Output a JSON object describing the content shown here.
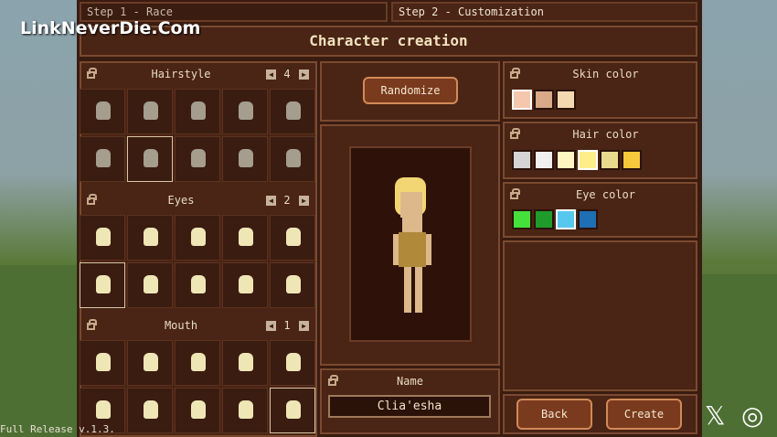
{
  "watermark": "LinkNeverDie.Com",
  "version_text": "Full Release v.1.3.",
  "tabs": [
    {
      "label": "Step 1 - Race"
    },
    {
      "label": "Step 2 - Customization"
    }
  ],
  "title": "Character creation",
  "hairstyle": {
    "label": "Hairstyle",
    "value": "4"
  },
  "eyes": {
    "label": "Eyes",
    "value": "2"
  },
  "mouth": {
    "label": "Mouth",
    "value": "1"
  },
  "buttons": {
    "randomize": "Randomize",
    "back": "Back",
    "create": "Create"
  },
  "skin_color": {
    "label": "Skin color",
    "swatches": [
      "#f5c7ad",
      "#d9a98a",
      "#f4d8b0"
    ],
    "selected_index": 0
  },
  "hair_color": {
    "label": "Hair color",
    "swatches": [
      "#d4d4d4",
      "#f0f0f0",
      "#fff6c2",
      "#ffee8a",
      "#e8d98e",
      "#f5c93a"
    ],
    "selected_index": 3
  },
  "eye_color": {
    "label": "Eye color",
    "swatches": [
      "#45e03a",
      "#1f9b2c",
      "#56c8ee",
      "#1f6fb4"
    ],
    "selected_index": 2
  },
  "name": {
    "label": "Name",
    "value": "Clia'esha"
  },
  "social": {
    "x_icon": "x-icon",
    "instagram_icon": "instagram-icon"
  }
}
